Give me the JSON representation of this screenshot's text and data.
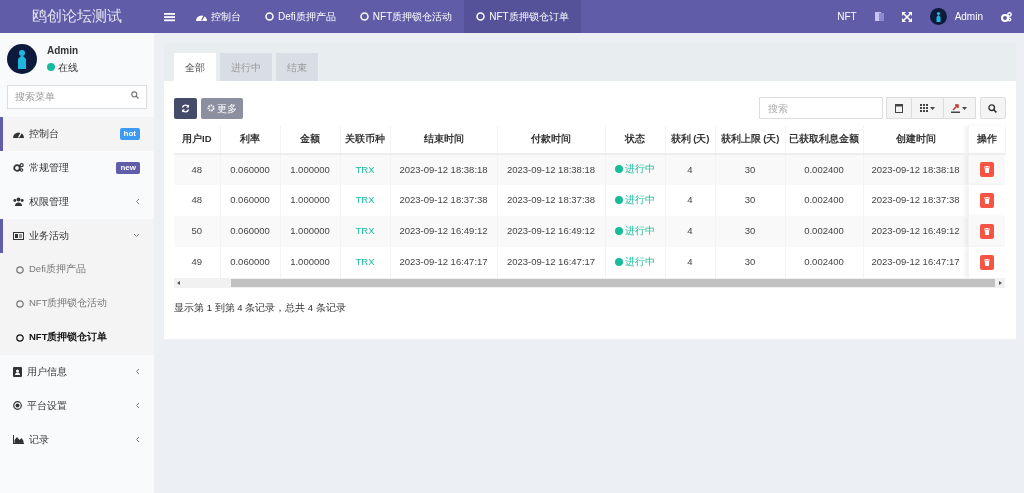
{
  "brand": "鸥创论坛测试",
  "topnav": {
    "tabs": [
      {
        "label": "控制台",
        "kind": "dashboard",
        "selected": false
      },
      {
        "label": "Defi质押产品",
        "kind": "circle",
        "selected": false
      },
      {
        "label": "NFT质押锁仓活动",
        "kind": "circle",
        "selected": false
      },
      {
        "label": "NFT质押锁仓订单",
        "kind": "circle",
        "selected": true
      }
    ],
    "site": "NFT",
    "user": "Admin"
  },
  "sidebar": {
    "user": {
      "name": "Admin",
      "status": "在线"
    },
    "search": {
      "placeholder": "搜索菜单"
    },
    "items": [
      {
        "label": "控制台",
        "kind": "badge",
        "badge": "hot",
        "color": "#3c9bf0",
        "selected": true
      },
      {
        "label": "常规管理",
        "kind": "badge",
        "badge": "new",
        "color": "#605ca8",
        "selected": false
      },
      {
        "label": "权限管理",
        "kind": "group",
        "expanded": false,
        "selected": false
      },
      {
        "label": "业务活动",
        "kind": "group",
        "expanded": true,
        "selected": true,
        "children": [
          {
            "label": "Defi质押产品",
            "selected": false
          },
          {
            "label": "NFT质押锁仓活动",
            "selected": false
          },
          {
            "label": "NFT质押锁仓订单",
            "selected": true
          }
        ]
      },
      {
        "label": "用户信息",
        "kind": "group",
        "expanded": false,
        "selected": false
      },
      {
        "label": "平台设置",
        "kind": "group",
        "expanded": false,
        "selected": false
      },
      {
        "label": "记录",
        "kind": "group",
        "expanded": false,
        "selected": false
      }
    ]
  },
  "panel": {
    "tabs": [
      {
        "label": "全部",
        "selected": true
      },
      {
        "label": "进行中",
        "selected": false
      },
      {
        "label": "结束",
        "selected": false
      }
    ],
    "toolbar": {
      "more": {
        "label": "更多",
        "disabled": true
      },
      "search": {
        "placeholder": "搜索"
      }
    },
    "table": {
      "columns": [
        "用户ID",
        "利率",
        "金额",
        "关联币种",
        "结束时间",
        "付款时间",
        "状态",
        "获利 (天)",
        "获利上限 (天)",
        "已获取利息金额",
        "创建时间",
        "操作"
      ],
      "rows": [
        {
          "user_id": "48",
          "rate": "0.060000",
          "amount": "1.000000",
          "coin": "TRX",
          "end_time": "2023-09-12 18:38:18",
          "pay_time": "2023-09-12 18:38:18",
          "status": "进行中",
          "profit_days": "4",
          "profit_limit": "30",
          "interest": "0.002400",
          "created": "2023-09-12 18:38:18"
        },
        {
          "user_id": "48",
          "rate": "0.060000",
          "amount": "1.000000",
          "coin": "TRX",
          "end_time": "2023-09-12 18:37:38",
          "pay_time": "2023-09-12 18:37:38",
          "status": "进行中",
          "profit_days": "4",
          "profit_limit": "30",
          "interest": "0.002400",
          "created": "2023-09-12 18:37:38"
        },
        {
          "user_id": "50",
          "rate": "0.060000",
          "amount": "1.000000",
          "coin": "TRX",
          "end_time": "2023-09-12 16:49:12",
          "pay_time": "2023-09-12 16:49:12",
          "status": "进行中",
          "profit_days": "4",
          "profit_limit": "30",
          "interest": "0.002400",
          "created": "2023-09-12 16:49:12"
        },
        {
          "user_id": "49",
          "rate": "0.060000",
          "amount": "1.000000",
          "coin": "TRX",
          "end_time": "2023-09-12 16:47:17",
          "pay_time": "2023-09-12 16:47:17",
          "status": "进行中",
          "profit_days": "4",
          "profit_limit": "30",
          "interest": "0.002400",
          "created": "2023-09-12 16:47:17"
        }
      ]
    },
    "footer": "显示第 1 到第 4 条记录，总共 4 条记录"
  }
}
